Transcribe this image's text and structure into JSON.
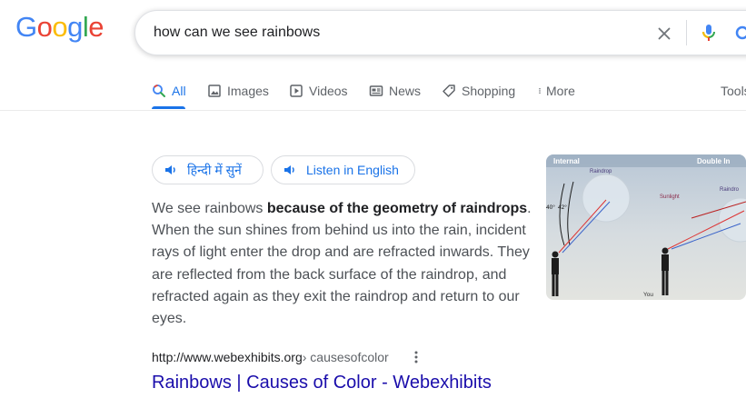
{
  "logo": {
    "letters": [
      {
        "char": "G",
        "color": "#4285F4"
      },
      {
        "char": "o",
        "color": "#EA4335"
      },
      {
        "char": "o",
        "color": "#FBBC05"
      },
      {
        "char": "g",
        "color": "#4285F4"
      },
      {
        "char": "l",
        "color": "#34A853"
      },
      {
        "char": "e",
        "color": "#EA4335"
      }
    ]
  },
  "search": {
    "query": "how can we see rainbows",
    "clear_icon": "close-icon",
    "voice_icon": "microphone-icon",
    "lens_icon": "camera-lens-icon"
  },
  "tabs": [
    {
      "label": "All",
      "icon": "search-icon",
      "active": true
    },
    {
      "label": "Images",
      "icon": "image-icon",
      "active": false
    },
    {
      "label": "Videos",
      "icon": "play-icon",
      "active": false
    },
    {
      "label": "News",
      "icon": "newspaper-icon",
      "active": false
    },
    {
      "label": "Shopping",
      "icon": "tag-icon",
      "active": false
    },
    {
      "label": "More",
      "icon": "vertical-dots-icon",
      "active": false
    }
  ],
  "tools_label": "Tools",
  "listen": {
    "hindi_label": "हिन्दी में सुनें",
    "english_label": "Listen in English"
  },
  "snippet": {
    "text_before": "We see rainbows ",
    "bold": "because of the geometry of raindrops",
    "text_after": ". When the sun shines from behind us into the rain, incident rays of light enter the drop and are refracted inwards. They are reflected from the back surface of the raindrop, and refracted again as they exit the raindrop and return to our eyes."
  },
  "result_image": {
    "label_internal": "Internal",
    "label_double": "Double In",
    "label_raindrop_left": "Raindrop",
    "label_raindrop_right": "Raindro",
    "label_sunlight": "Sunlight",
    "label_you": "You",
    "label_angle_40": "40°",
    "label_angle_42": "42°"
  },
  "result": {
    "url": "http://www.webexhibits.org",
    "path": " › causesofcolor",
    "title": "Rainbows | Causes of Color - Webexhibits"
  },
  "colors": {
    "accent": "#1a73e8",
    "link": "#1a0dab"
  }
}
